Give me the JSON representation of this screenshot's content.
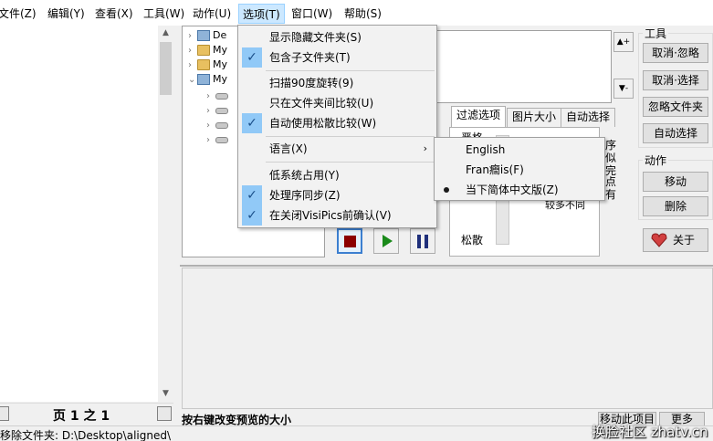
{
  "menubar": {
    "items": [
      "文件(Z)",
      "编辑(Y)",
      "查看(X)",
      "工具(W)",
      "动作(U)",
      "选项(T)",
      "窗口(W)",
      "帮助(S)"
    ]
  },
  "tree": {
    "items": [
      "De",
      "My",
      "My",
      "My"
    ]
  },
  "left_panel": {
    "page_label": "页 1 之 1"
  },
  "tabs": [
    "过滤选项",
    "图片大小",
    "自动选择"
  ],
  "filter_tab": {
    "top_label": "严格",
    "bottom_label": "松散",
    "partial_text": [
      "序",
      "似",
      "完",
      "点",
      "有"
    ],
    "note": "较多不同"
  },
  "tools": {
    "group_label": "工具",
    "buttons": [
      "取消·忽略",
      "取消·选择",
      "忽略文件夹",
      "自动选择"
    ]
  },
  "actions": {
    "group_label": "动作",
    "buttons": [
      "移动",
      "删除"
    ],
    "about": "关于"
  },
  "options_menu": {
    "items": [
      {
        "label": "显示隐藏文件夹(S)",
        "checked": false
      },
      {
        "label": "包含子文件夹(T)",
        "checked": true
      },
      {
        "label": "扫描90度旋转(9)",
        "checked": false
      },
      {
        "label": "只在文件夹间比较(U)",
        "checked": false
      },
      {
        "label": "自动使用松散比较(W)",
        "checked": true
      },
      {
        "label": "语言(X)",
        "checked": false
      },
      {
        "label": "低系统占用(Y)",
        "checked": false
      },
      {
        "label": "处理序同步(Z)",
        "checked": true
      },
      {
        "label": "在关闭VisiPics前确认(V)",
        "checked": true
      }
    ],
    "submenu_arrow": "›"
  },
  "language_submenu": {
    "items": [
      "English",
      "Fran癎is(F)",
      "当下简体中文版(Z)"
    ],
    "selected": "当下简体中文版(Z)"
  },
  "hint": {
    "text": "按右键改变预览的大小",
    "move_button": "移动此项目",
    "more_button": "更多"
  },
  "status": {
    "text": "移除文件夹:    D:\\Desktop\\aligned\\"
  },
  "watermark": "换脸社区 zhatv.cn",
  "colors": {
    "highlight": "#91c9f7",
    "menu_active": "#cce8ff",
    "stop": "#8b0000",
    "play": "#1a8a1a",
    "pause": "#1f2f7a"
  }
}
